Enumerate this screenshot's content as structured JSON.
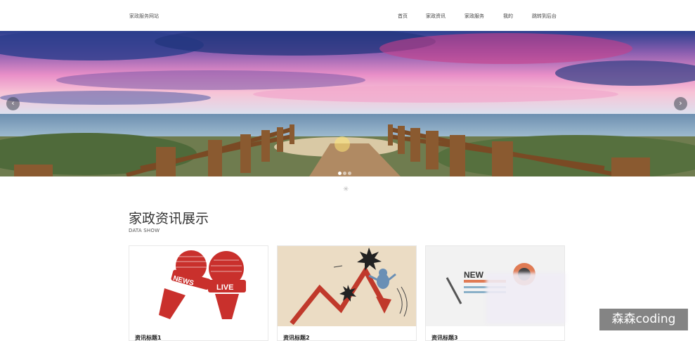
{
  "header": {
    "brand": "家政服务网站",
    "nav": [
      "首页",
      "家政资讯",
      "家政服务",
      "我的",
      "跳转到后台"
    ]
  },
  "banner": {
    "prev_glyph": "‹",
    "next_glyph": "›",
    "slide_count": 3,
    "active_slide": 1
  },
  "section": {
    "title": "家政资讯展示",
    "subtitle": "DATA SHOW"
  },
  "cards": [
    {
      "title": "资讯标题1",
      "image": "news-microphones"
    },
    {
      "title": "资讯标题2",
      "image": "stock-crash-illustration"
    },
    {
      "title": "资讯标题3",
      "image": "newspaper-icon"
    }
  ],
  "card1_image_text": {
    "news": "NEWS",
    "live": "LIVE"
  },
  "card3_image_text": "NEW",
  "watermark": "森森coding",
  "colors": {
    "mic_red": "#c9302c",
    "bg_beige": "#ebdcc4",
    "arrow_red": "#c0392b"
  }
}
